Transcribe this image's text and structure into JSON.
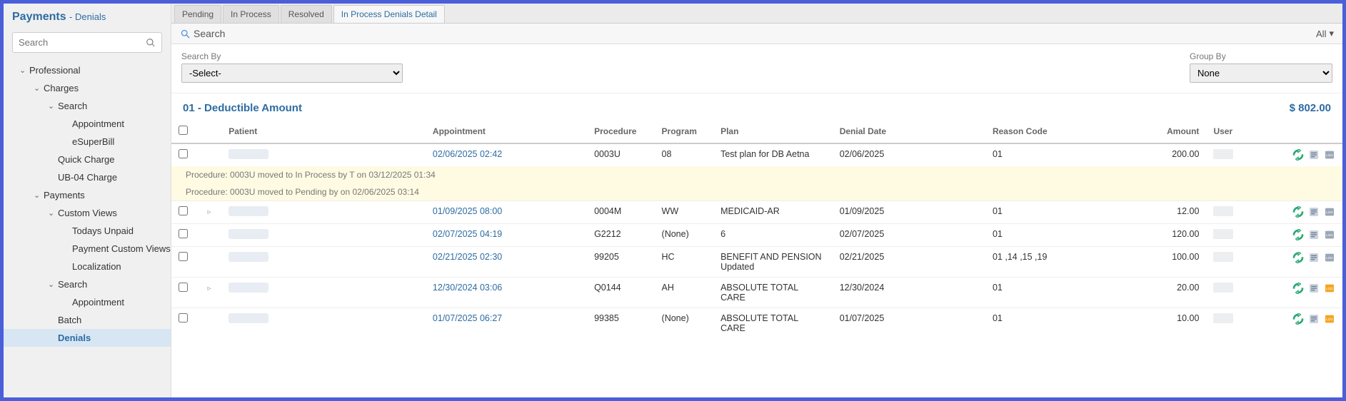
{
  "sidebar": {
    "title": "Payments",
    "subtitle": "- Denials",
    "search_placeholder": "Search",
    "tree": [
      {
        "lvl": 0,
        "chev": "v",
        "label": "Professional"
      },
      {
        "lvl": 1,
        "chev": "v",
        "label": "Charges"
      },
      {
        "lvl": 2,
        "chev": "v",
        "label": "Search"
      },
      {
        "lvl": 3,
        "chev": "",
        "label": "Appointment"
      },
      {
        "lvl": 3,
        "chev": "",
        "label": "eSuperBill"
      },
      {
        "lvl": 2,
        "chev": "",
        "label": "Quick Charge"
      },
      {
        "lvl": 2,
        "chev": "",
        "label": "UB-04 Charge"
      },
      {
        "lvl": 1,
        "chev": "v",
        "label": "Payments"
      },
      {
        "lvl": 2,
        "chev": "v",
        "label": "Custom Views"
      },
      {
        "lvl": 3,
        "chev": "",
        "label": "Todays Unpaid"
      },
      {
        "lvl": 3,
        "chev": "",
        "label": "Payment Custom Views"
      },
      {
        "lvl": 3,
        "chev": "",
        "label": "Localization"
      },
      {
        "lvl": 2,
        "chev": "v",
        "label": "Search"
      },
      {
        "lvl": 3,
        "chev": "",
        "label": "Appointment"
      },
      {
        "lvl": 2,
        "chev": "",
        "label": "Batch"
      },
      {
        "lvl": 2,
        "chev": "",
        "label": "Denials",
        "selected": true
      }
    ]
  },
  "tabs": [
    "Pending",
    "In Process",
    "Resolved",
    "In Process Denials Detail"
  ],
  "active_tab": 3,
  "searchbar": {
    "label": "Search",
    "all": "All"
  },
  "filters": {
    "search_by_label": "Search By",
    "search_by_value": "-Select-",
    "group_by_label": "Group By",
    "group_by_value": "None"
  },
  "group": {
    "name": "01 - Deductible Amount",
    "total": "$ 802.00"
  },
  "columns": {
    "patient": "Patient",
    "appointment": "Appointment",
    "procedure": "Procedure",
    "program": "Program",
    "plan": "Plan",
    "denial_date": "Denial Date",
    "reason": "Reason Code",
    "amount": "Amount",
    "user": "User"
  },
  "rows": [
    {
      "expand": "",
      "appt": "02/06/2025 02:42",
      "proc": "0003U",
      "prog": "08",
      "plan": "Test plan for DB Aetna",
      "date": "02/06/2025",
      "reason": "01",
      "amount": "200.00",
      "log": "gray",
      "history": [
        "Procedure: 0003U moved to In Process by T            on 03/12/2025 01:34",
        "Procedure: 0003U moved to Pending by              on 02/06/2025 03:14"
      ]
    },
    {
      "expand": "▹",
      "appt": "01/09/2025 08:00",
      "proc": "0004M",
      "prog": "WW",
      "plan": "MEDICAID-AR",
      "date": "01/09/2025",
      "reason": "01",
      "amount": "12.00",
      "log": "gray"
    },
    {
      "expand": "",
      "appt": "02/07/2025 04:19",
      "proc": "G2212",
      "prog": "(None)",
      "plan": "6",
      "date": "02/07/2025",
      "reason": "01",
      "amount": "120.00",
      "log": "gray"
    },
    {
      "expand": "",
      "appt": "02/21/2025 02:30",
      "proc": "99205",
      "prog": "HC",
      "plan": "BENEFIT AND PENSION Updated",
      "date": "02/21/2025",
      "reason": "01 ,14 ,15 ,19",
      "amount": "100.00",
      "log": "gray"
    },
    {
      "expand": "▹",
      "appt": "12/30/2024 03:06",
      "proc": "Q0144",
      "prog": "AH",
      "plan": "ABSOLUTE TOTAL CARE",
      "date": "12/30/2024",
      "reason": "01",
      "amount": "20.00",
      "log": "orange"
    },
    {
      "expand": "",
      "appt": "01/07/2025 06:27",
      "proc": "99385",
      "prog": "(None)",
      "plan": "ABSOLUTE TOTAL CARE",
      "date": "01/07/2025",
      "reason": "01",
      "amount": "10.00",
      "log": "orange"
    }
  ]
}
